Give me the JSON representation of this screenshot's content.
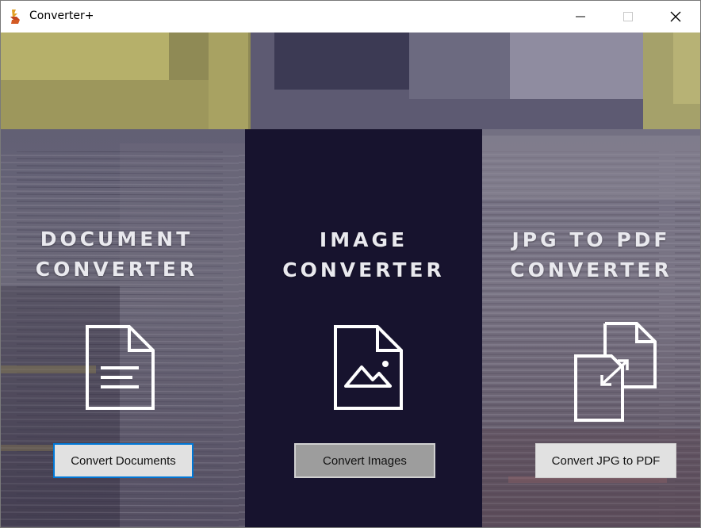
{
  "window": {
    "title": "Converter+",
    "app_icon": "converter-app-icon",
    "controls": [
      "minimize-icon",
      "maximize-icon",
      "close-icon"
    ]
  },
  "panels": [
    {
      "title_line1": "DOCUMENT",
      "title_line2": "CONVERTER",
      "icon": "document-file-icon",
      "button_label": "Convert Documents"
    },
    {
      "title_line1": "IMAGE",
      "title_line2": "CONVERTER",
      "icon": "image-file-icon",
      "button_label": "Convert Images"
    },
    {
      "title_line1": "JPG TO PDF",
      "title_line2": "CONVERTER",
      "icon": "file-transfer-icon",
      "button_label": "Convert JPG to PDF"
    }
  ],
  "colors": {
    "middle_panel": "#17132e",
    "title_text": "#e9e9ee",
    "focus_border": "#0078d7",
    "olive_accent": "#a9a35a"
  }
}
